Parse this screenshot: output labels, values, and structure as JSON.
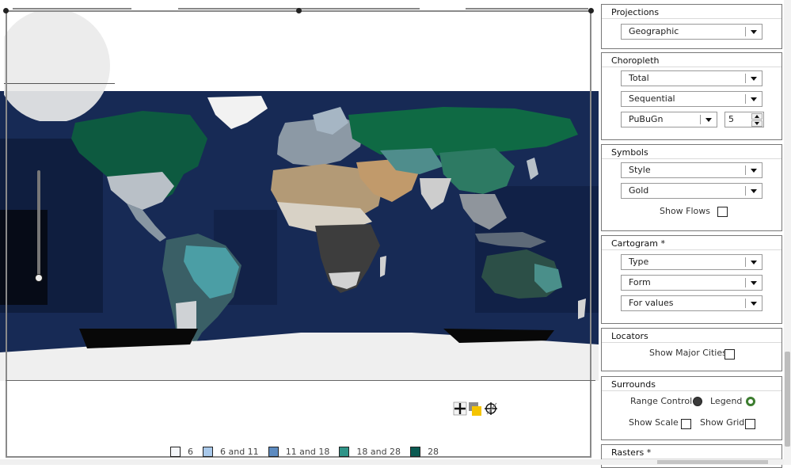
{
  "legend": [
    {
      "label": "6",
      "color": "#f4f6f9"
    },
    {
      "label": "6 and 11",
      "color": "#a8c8ea"
    },
    {
      "label": "11 and 18",
      "color": "#5d8bc0"
    },
    {
      "label": "18 and 28",
      "color": "#2f9488"
    },
    {
      "label": "28",
      "color": "#0b5a52"
    }
  ],
  "map": {
    "ocean_color": "#172a55",
    "land_color": "#0d4a3a",
    "ice_color": "#f2f2f2",
    "tool_icons": [
      "move-icon",
      "layers-icon",
      "locate-icon"
    ]
  },
  "panel": {
    "projections": {
      "title": "Projections",
      "select": "Geographic"
    },
    "choropleth": {
      "title": "Choropleth",
      "variable": "Total",
      "scheme_type": "Sequential",
      "palette": "PuBuGn",
      "classes": "5"
    },
    "symbols": {
      "title": "Symbols",
      "style": "Style",
      "color": "Gold",
      "show_flows_label": "Show Flows"
    },
    "cartogram": {
      "title": "Cartogram *",
      "type": "Type",
      "form": "Form",
      "for_values": "For values"
    },
    "locators": {
      "title": "Locators",
      "show_major_cities_label": "Show Major Cities"
    },
    "surrounds": {
      "title": "Surrounds",
      "range_control_label": "Range Control",
      "legend_label": "Legend",
      "show_scale_label": "Show Scale",
      "show_grid_label": "Show Grid"
    },
    "rasters": {
      "title": "Rasters *"
    }
  }
}
